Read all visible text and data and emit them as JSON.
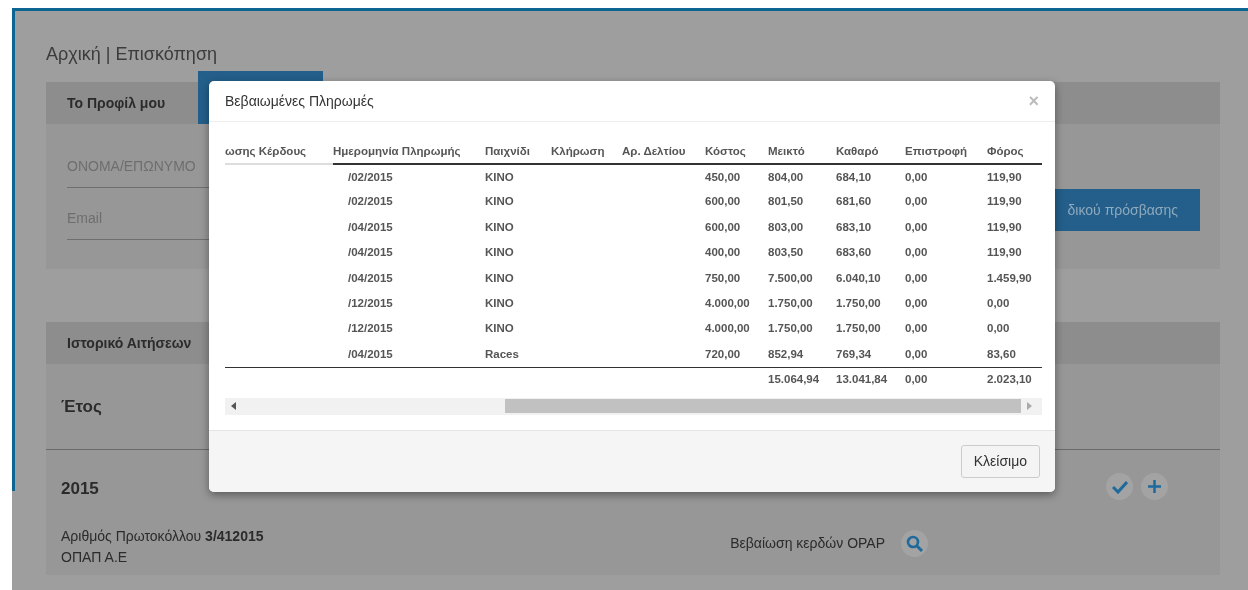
{
  "page": {
    "breadcrumb": "Αρχική | Επισκόπηση"
  },
  "profile": {
    "title": "Το Προφίλ μου",
    "fields": [
      {
        "placeholder": "ΟΝΟΜΑ/ΕΠΩΝΥΜΟ"
      },
      {
        "placeholder": "Email"
      }
    ],
    "button": "δικού πρόσβασης"
  },
  "history": {
    "title": "Ιστορικό Αιτήσεων",
    "column_1": "Έτος",
    "year": "2015",
    "protocol_label": "Αριθμός Πρωτοκόλλου",
    "protocol_number": "3/412015",
    "organization": "ΟΠΑΠ Α.Ε",
    "certificate": "Βεβαίωση κερδών OPAP"
  },
  "modal": {
    "title": "Βεβαιωμένες Πληρωμές",
    "close": "×",
    "columns": [
      "ωσης Κέρδους",
      "Ημερομηνία Πληρωμής",
      "Παιχνίδι",
      "Κλήρωση",
      "Αρ. Δελτίου",
      "Κόστος",
      "Μεικτό",
      "Καθαρό",
      "Επιστροφή",
      "Φόρος"
    ],
    "rows": [
      {
        "date": "/02/2015",
        "game": "ΚΙΝΟ",
        "cost": "450,00",
        "gross": "804,00",
        "net": "684,10",
        "refund": "0,00",
        "tax": "119,90"
      },
      {
        "date": "/02/2015",
        "game": "ΚΙΝΟ",
        "cost": "600,00",
        "gross": "801,50",
        "net": "681,60",
        "refund": "0,00",
        "tax": "119,90"
      },
      {
        "date": "/04/2015",
        "game": "ΚΙΝΟ",
        "cost": "600,00",
        "gross": "803,00",
        "net": "683,10",
        "refund": "0,00",
        "tax": "119,90"
      },
      {
        "date": "/04/2015",
        "game": "ΚΙΝΟ",
        "cost": "400,00",
        "gross": "803,50",
        "net": "683,60",
        "refund": "0,00",
        "tax": "119,90"
      },
      {
        "date": "/04/2015",
        "game": "ΚΙΝΟ",
        "cost": "750,00",
        "gross": "7.500,00",
        "net": "6.040,10",
        "refund": "0,00",
        "tax": "1.459,90"
      },
      {
        "date": "/12/2015",
        "game": "ΚΙΝΟ",
        "cost": "4.000,00",
        "gross": "1.750,00",
        "net": "1.750,00",
        "refund": "0,00",
        "tax": "0,00"
      },
      {
        "date": "/12/2015",
        "game": "ΚΙΝΟ",
        "cost": "4.000,00",
        "gross": "1.750,00",
        "net": "1.750,00",
        "refund": "0,00",
        "tax": "0,00"
      },
      {
        "date": "/04/2015",
        "game": "Races",
        "cost": "720,00",
        "gross": "852,94",
        "net": "769,34",
        "refund": "0,00",
        "tax": "83,60"
      }
    ],
    "totals": {
      "gross": "15.064,94",
      "net": "13.041,84",
      "refund": "0,00",
      "tax": "2.023,10"
    },
    "close_button": "Κλείσιμο"
  }
}
